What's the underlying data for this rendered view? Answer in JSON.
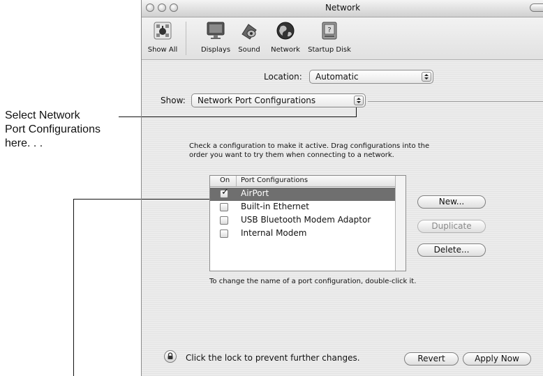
{
  "callout": {
    "line1_prefix": "Select ",
    "line1_bold": "Network",
    "line2": "Port Configurations",
    "line3": "here. . ."
  },
  "window": {
    "title": "Network"
  },
  "toolbar": {
    "items": [
      {
        "label": "Show All",
        "icon": "apple-logo-icon"
      },
      {
        "label": "Displays",
        "icon": "display-icon"
      },
      {
        "label": "Sound",
        "icon": "speaker-icon"
      },
      {
        "label": "Network",
        "icon": "globe-icon"
      },
      {
        "label": "Startup Disk",
        "icon": "hard-disk-icon"
      }
    ]
  },
  "location": {
    "label": "Location:",
    "value": "Automatic"
  },
  "show": {
    "label": "Show:",
    "value": "Network Port Configurations"
  },
  "instructions": {
    "line1": "Check a configuration to make it active. Drag configurations into the",
    "line2": "order you want to try them when connecting to a network."
  },
  "port_table": {
    "headers": [
      "On",
      "Port Configurations"
    ],
    "rows": [
      {
        "name": "AirPort",
        "checked": true
      },
      {
        "name": "Built-in Ethernet",
        "checked": false
      },
      {
        "name": "USB Bluetooth Modem Adaptor",
        "checked": false
      },
      {
        "name": "Internal Modem",
        "checked": false
      }
    ]
  },
  "buttons": {
    "new": "New...",
    "duplicate": "Duplicate",
    "delete": "Delete...",
    "revert": "Revert",
    "apply_now": "Apply Now"
  },
  "rename_hint": "To change the name of a port configuration, double-click it.",
  "lock_text": "Click the lock to prevent further changes.",
  "colors": {
    "selection": "#6f6f6f",
    "window_bg": "#ececec"
  }
}
